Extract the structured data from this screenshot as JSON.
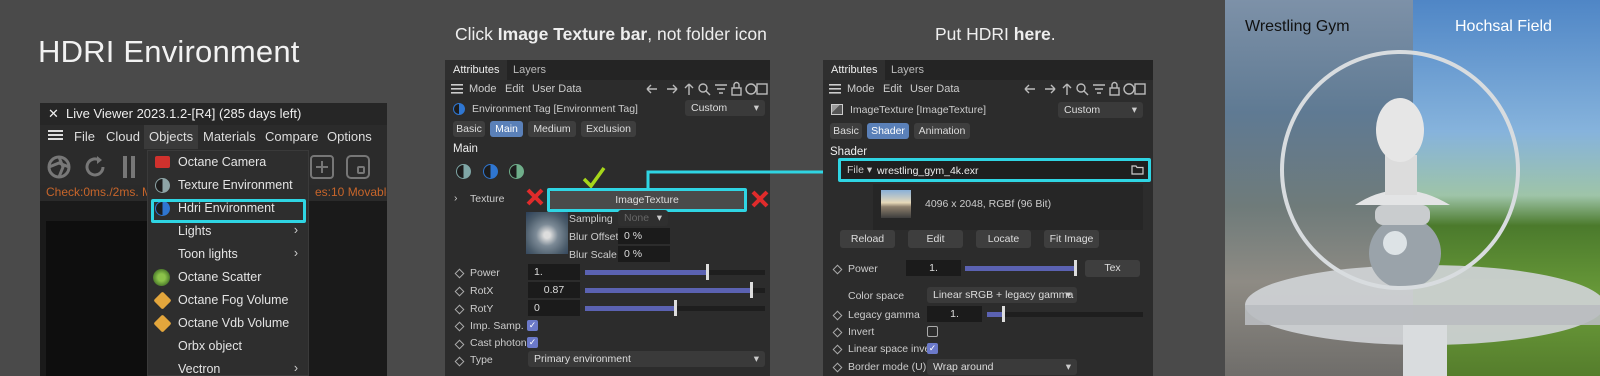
{
  "panel1": {
    "title": "HDRI Environment",
    "window_title": "Live Viewer 2023.1.2-[R4] (285 days left)",
    "close_glyph": "✕",
    "menu": [
      "File",
      "Cloud",
      "Objects",
      "Materials",
      "Compare",
      "Options"
    ],
    "status_text": "Check:0ms./2ms. M",
    "status_text_right": "es:10 Movable",
    "dropdown_items": [
      {
        "label": "Octane Camera",
        "icon": "camera-icon",
        "color": "#d0312d",
        "submenu": false
      },
      {
        "label": "Texture Environment",
        "icon": "half-circle-icon",
        "color": "#8da4a6",
        "submenu": false
      },
      {
        "label": "Hdri Environment",
        "icon": "half-circle-icon",
        "color": "#2f76d1",
        "submenu": false
      },
      {
        "label": "Lights",
        "icon": "",
        "color": "",
        "submenu": true
      },
      {
        "label": "Toon lights",
        "icon": "",
        "color": "",
        "submenu": true
      },
      {
        "label": "Octane Scatter",
        "icon": "scatter-icon",
        "color": "#6aa84f",
        "submenu": false
      },
      {
        "label": "Octane Fog Volume",
        "icon": "cube-icon",
        "color": "#e3a63c",
        "submenu": false
      },
      {
        "label": "Octane Vdb Volume",
        "icon": "cube-icon",
        "color": "#e3a63c",
        "submenu": false
      },
      {
        "label": "Orbx object",
        "icon": "",
        "color": "",
        "submenu": false
      },
      {
        "label": "Vectron",
        "icon": "",
        "color": "",
        "submenu": true
      }
    ],
    "highlight_color": "#2fd5e3"
  },
  "panel2": {
    "instruction_prefix": "Click ",
    "instruction_bold": "Image Texture bar",
    "instruction_suffix": ", not folder icon",
    "tabs": [
      "Attributes",
      "Layers"
    ],
    "menu": [
      "Mode",
      "Edit",
      "User Data"
    ],
    "object_name": "Environment Tag [Environment Tag]",
    "preset": "Custom",
    "subtabs": [
      "Basic",
      "Main",
      "Medium",
      "Exclusion"
    ],
    "active_subtab": "Main",
    "section": "Main",
    "texture_label": "Texture",
    "texture_button": "ImageTexture",
    "sampling_label": "Sampling",
    "sampling_value": "None",
    "blur_offset_label": "Blur Offset",
    "blur_offset_value": "0 %",
    "blur_scale_label": "Blur Scale",
    "blur_scale_value": "0 %",
    "params": [
      {
        "label": "Power",
        "value": "1.",
        "fill": 0.68
      },
      {
        "label": "RotX",
        "value": "0.87",
        "fill": 0.92
      },
      {
        "label": "RotY",
        "value": "0",
        "fill": 0.5
      }
    ],
    "imp_samp_label": "Imp. Samp.",
    "imp_samp": true,
    "cast_photons_label": "Cast photons",
    "cast_photons": true,
    "type_label": "Type",
    "type_value": "Primary environment"
  },
  "panel3": {
    "instruction_prefix": "Put HDRI ",
    "instruction_bold": "here",
    "instruction_suffix": ".",
    "tabs": [
      "Attributes",
      "Layers"
    ],
    "menu": [
      "Mode",
      "Edit",
      "User Data"
    ],
    "object_name": "ImageTexture [ImageTexture]",
    "preset": "Custom",
    "subtabs": [
      "Basic",
      "Shader",
      "Animation"
    ],
    "active_subtab": "Shader",
    "section": "Shader",
    "file_label": "File",
    "file_value": "wrestling_gym_4k.exr",
    "image_info": "4096 x 2048, RGBf (96 Bit)",
    "buttons": [
      "Reload",
      "Edit",
      "Locate",
      "Fit Image"
    ],
    "power_label": "Power",
    "power_value": "1.",
    "power_fill": 1.0,
    "tex_button": "Tex",
    "colorspace_label": "Color space",
    "colorspace_value": "Linear sRGB + legacy gamma",
    "legacy_gamma_label": "Legacy gamma",
    "legacy_gamma_value": "1.",
    "legacy_gamma_fill": 0.1,
    "invert_label": "Invert",
    "invert": false,
    "linear_invert_label": "Linear space invert",
    "linear_invert": true,
    "border_mode_label": "Border mode (U)",
    "border_mode_value": "Wrap around"
  },
  "panel4": {
    "left_label": "Wrestling Gym",
    "right_label": "Hochsal Field"
  }
}
